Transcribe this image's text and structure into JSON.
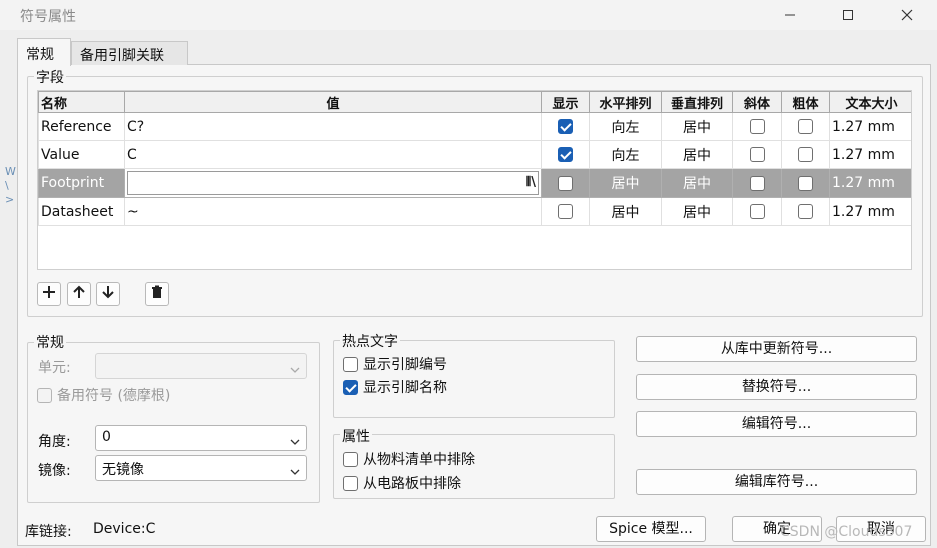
{
  "window": {
    "title": "符号属性",
    "controls": [
      "minimize-icon",
      "maximize-icon",
      "close-icon"
    ]
  },
  "tabs": [
    {
      "label": "常规",
      "active": true
    },
    {
      "label": "备用引脚关联",
      "active": false
    }
  ],
  "fields": {
    "group_label": "字段",
    "columns": [
      "名称",
      "值",
      "显示",
      "水平排列",
      "垂直排列",
      "斜体",
      "粗体",
      "文本大小"
    ],
    "rows": [
      {
        "name": "Reference",
        "value": "C?",
        "show": true,
        "h_align": "向左",
        "v_align": "居中",
        "italic": false,
        "bold": false,
        "size": "1.27 mm"
      },
      {
        "name": "Value",
        "value": "C",
        "show": true,
        "h_align": "向左",
        "v_align": "居中",
        "italic": false,
        "bold": false,
        "size": "1.27 mm"
      },
      {
        "name": "Footprint",
        "value": "",
        "show": false,
        "h_align": "居中",
        "v_align": "居中",
        "italic": false,
        "bold": false,
        "size": "1.27 mm"
      },
      {
        "name": "Datasheet",
        "value": "~",
        "show": false,
        "h_align": "居中",
        "v_align": "居中",
        "italic": false,
        "bold": false,
        "size": "1.27 mm"
      }
    ],
    "selected_row": 2,
    "toolbar_icons": [
      "plus-icon",
      "arrow-up-icon",
      "arrow-down-icon",
      "trash-icon"
    ]
  },
  "general": {
    "group_label": "常规",
    "unit_label": "单元:",
    "unit_value": "",
    "alt_symbol_label": "备用符号 (德摩根)",
    "angle_label": "角度:",
    "angle_value": "0",
    "mirror_label": "镜像:",
    "mirror_value": "无镜像"
  },
  "hotspot": {
    "group_label": "热点文字",
    "show_pin_number": {
      "label": "显示引脚编号",
      "checked": false
    },
    "show_pin_name": {
      "label": "显示引脚名称",
      "checked": true
    }
  },
  "attributes": {
    "group_label": "属性",
    "exclude_bom": {
      "label": "从物料清单中排除",
      "checked": false
    },
    "exclude_board": {
      "label": "从电路板中排除",
      "checked": false
    }
  },
  "actions": {
    "update_from_library": "从库中更新符号...",
    "replace_symbol": "替换符号...",
    "edit_symbol": "编辑符号...",
    "edit_library_symbol": "编辑库符号..."
  },
  "footer": {
    "lib_link_label": "库链接:",
    "lib_link_value": "Device:C",
    "spice_button": "Spice 模型...",
    "ok_button": "确定",
    "cancel_button": "取消"
  },
  "overlay": {
    "left_edge_text": "W\n\\\n>",
    "watermark": "CSDN @Clouds307"
  },
  "colors": {
    "accent": "#1a5fb4",
    "selected_row": "#a4a4a4"
  }
}
